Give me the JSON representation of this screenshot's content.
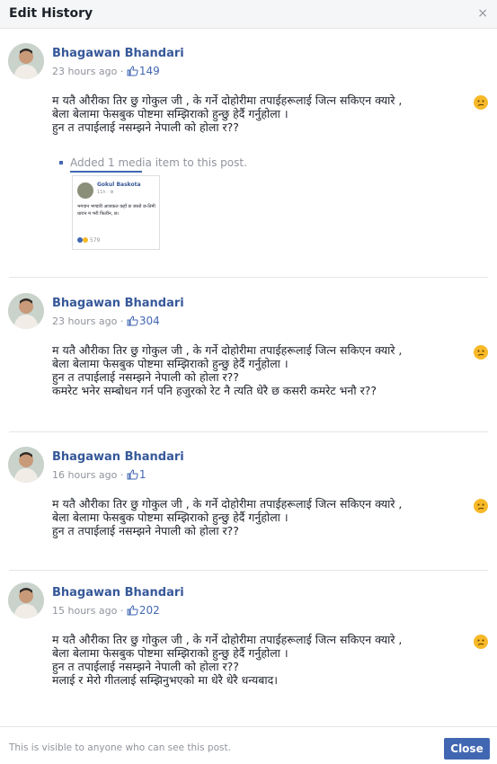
{
  "dialog": {
    "title": "Edit History",
    "close_glyph": "×"
  },
  "entries": [
    {
      "author": "Bhagawan Bhandari",
      "time": "23 hours ago · ",
      "likes": "149",
      "lines": [
        "म यतै औरीका तिर छु गोकुल जी , के गर्ने दोहोरीमा तपाईहरूलाई जित्न सकिएन क्यारे ,",
        "बेला बेलामा फेसबुक पोष्टमा सम्झिराको हुन्छु हेर्दै गर्नुहोला ।",
        "हुन त तपाईलाई नसम्झने नेपाली को होला र??"
      ],
      "attachment": {
        "label": "Added 1 media item to this post.",
        "card_name": "Gokul Baskota",
        "card_time": "11h · ⚙",
        "card_text": "भगवान भण्डारी आजकल कहाँ छ जस्तो छ-तिमी धारान म भरी फिलीन, छ।",
        "card_reactions": "579"
      }
    },
    {
      "author": "Bhagawan Bhandari",
      "time": "23 hours ago · ",
      "likes": "304",
      "lines": [
        "म यतै औरीका तिर छु गोकुल जी , के गर्ने दोहोरीमा तपाईहरूलाई जित्न सकिएन क्यारे ,",
        "बेला बेलामा फेसबुक पोष्टमा सम्झिराको हुन्छु हेर्दै गर्नुहोला ।",
        "हुन त तपाईलाई नसम्झने नेपाली को होला र??",
        "कमरेट भनेर सम्बोधन गर्न पनि हजुरको रेट नै त्यति धेरै छ कसरी कमरेट भनौ र??"
      ]
    },
    {
      "author": "Bhagawan Bhandari",
      "time": "16 hours ago · ",
      "likes": "1",
      "lines": [
        "म यतै औरीका तिर छु गोकुल जी , के गर्ने दोहोरीमा तपाईहरूलाई जित्न सकिएन क्यारे ,",
        "बेला बेलामा फेसबुक पोष्टमा सम्झिराको हुन्छु हेर्दै गर्नुहोला ।",
        "हुन त तपाईलाई नसम्झने नेपाली को होला र??"
      ]
    },
    {
      "author": "Bhagawan Bhandari",
      "time": "15 hours ago · ",
      "likes": "202",
      "lines": [
        "म यतै औरीका तिर छु गोकुल जी , के गर्ने दोहोरीमा तपाईहरूलाई जित्न सकिएन क्यारे ,",
        "बेला बेलामा फेसबुक पोष्टमा सम्झिराको हुन्छु हेर्दै गर्नुहोला ।",
        "हुन त तपाईलाई नसम्झने नेपाली को होला र??",
        "मलाई र मेरो गीतलाई सम्झिनुभएको मा धेरै धेरै धन्यबाद।"
      ]
    }
  ],
  "footer": {
    "note": "This is visible to anyone who can see this post.",
    "close_label": "Close"
  },
  "colors": {
    "link": "#365899",
    "button": "#4267b2",
    "muted": "#90949c",
    "emoji": "#f7b928"
  }
}
